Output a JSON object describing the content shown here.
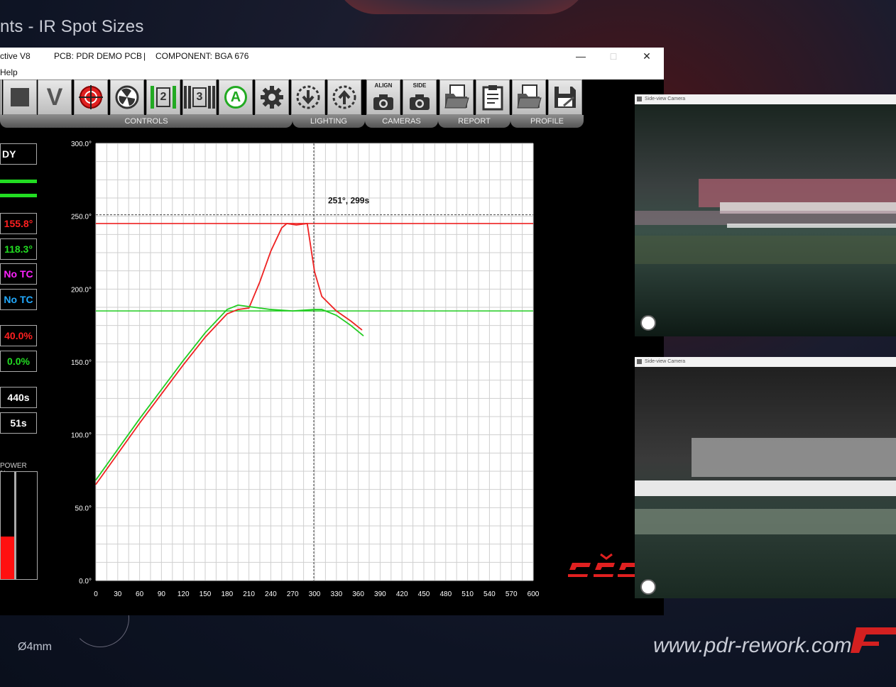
{
  "background": {
    "title": "nts - IR Spot Sizes",
    "url": "www.pdr-rework.com",
    "dimension_label": "Ø4mm"
  },
  "window": {
    "app_title": "ctive V8",
    "pcb": "PCB: PDR DEMO PCB",
    "separator": "|",
    "component": "COMPONENT: BGA 676",
    "minimize": "—",
    "maximize": "□",
    "close": "✕",
    "menu_help": "Help"
  },
  "toolbar": {
    "stop_icon": "stop-icon",
    "v_label": "V",
    "profile2_label": "2",
    "profile3_label": "3",
    "auto_label": "A",
    "align_label": "ALIGN",
    "side_label": "SIDE",
    "groups": [
      "CONTROLS",
      "LIGHTING",
      "CAMERAS",
      "REPORT",
      "PROFILE"
    ]
  },
  "status": {
    "state": "DY",
    "tc1": "155.8°",
    "tc2": "118.3°",
    "tc3": "No TC",
    "tc4": "No TC",
    "power_top": "40.0%",
    "power_bottom": "0.0%",
    "total_time": "440s",
    "stage_time": "51s",
    "power_label": "POWER %",
    "power_bar_fraction": 0.4,
    "colors": {
      "tc1": "#ff2020",
      "tc2": "#22dd22",
      "tc3": "#ff22ff",
      "tc4": "#22aaff",
      "power_top": "#ff2020",
      "power_bottom": "#22dd22"
    }
  },
  "cursor_label": "251°, 299s",
  "cameras": [
    {
      "title": "Side-view Camera"
    },
    {
      "title": "Side-view Camera"
    }
  ],
  "chart_data": {
    "type": "line",
    "xlim": [
      0,
      600
    ],
    "ylim": [
      0,
      300
    ],
    "x_ticks": [
      "0",
      "30",
      "60",
      "90",
      "120",
      "150",
      "180",
      "210",
      "240",
      "270",
      "300",
      "330",
      "360",
      "390",
      "420",
      "450",
      "480",
      "510",
      "540",
      "570",
      "600"
    ],
    "y_ticks": [
      "0.0°",
      "50.0°",
      "100.0°",
      "150.0°",
      "200.0°",
      "250.0°",
      "300.0°"
    ],
    "grid": true,
    "reference_lines": [
      {
        "y": 245,
        "color": "#ee2222"
      },
      {
        "y": 185,
        "color": "#22cc22"
      }
    ],
    "cursor": {
      "x": 299,
      "y": 251
    },
    "series": [
      {
        "color": "#ee2222",
        "x": [
          0,
          30,
          60,
          90,
          120,
          150,
          180,
          195,
          210,
          225,
          240,
          255,
          262,
          275,
          290,
          300,
          310,
          330,
          350,
          365
        ],
        "y": [
          66,
          87,
          108,
          128,
          148,
          167,
          183,
          186,
          187,
          205,
          226,
          242,
          245,
          244,
          245,
          212,
          195,
          185,
          178,
          172
        ]
      },
      {
        "color": "#22cc22",
        "x": [
          0,
          30,
          60,
          90,
          120,
          150,
          180,
          195,
          210,
          240,
          270,
          300,
          310,
          330,
          350,
          367
        ],
        "y": [
          69,
          90,
          111,
          131,
          151,
          170,
          186,
          189,
          188,
          186,
          185,
          186,
          186,
          182,
          175,
          168
        ]
      }
    ]
  }
}
